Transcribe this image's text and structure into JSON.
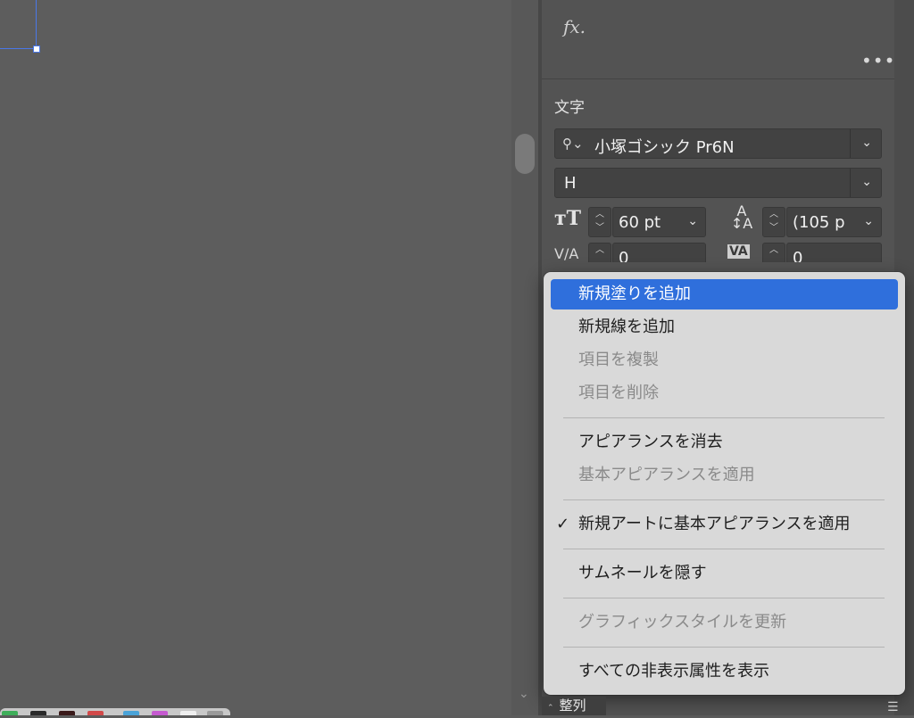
{
  "panel": {
    "fx_label": "fx.",
    "more_label": "•••",
    "section_title": "文字",
    "font_family": "小塚ゴシック Pr6N",
    "font_style": "H",
    "font_size": "60 pt",
    "leading": "(105 p",
    "tracking_value": "0",
    "kerning_value": "0"
  },
  "menu": {
    "items": [
      {
        "label": "新規塗りを追加",
        "state": "highlighted"
      },
      {
        "label": "新規線を追加",
        "state": "enabled"
      },
      {
        "label": "項目を複製",
        "state": "disabled"
      },
      {
        "label": "項目を削除",
        "state": "disabled"
      },
      {
        "label": "アピアランスを消去",
        "state": "enabled"
      },
      {
        "label": "基本アピアランスを適用",
        "state": "disabled"
      },
      {
        "label": "新規アートに基本アピアランスを適用",
        "state": "checked"
      },
      {
        "label": "サムネールを隠す",
        "state": "enabled"
      },
      {
        "label": "グラフィックスタイルを更新",
        "state": "disabled"
      },
      {
        "label": "すべての非表示属性を表示",
        "state": "enabled"
      }
    ],
    "check_mark": "✓"
  },
  "bottom_tab": {
    "label": "整列"
  },
  "colors": {
    "highlight": "#2f6fdc",
    "selection": "#4a78e8",
    "panel_bg": "#535353",
    "menu_bg": "#d9d9d9"
  }
}
